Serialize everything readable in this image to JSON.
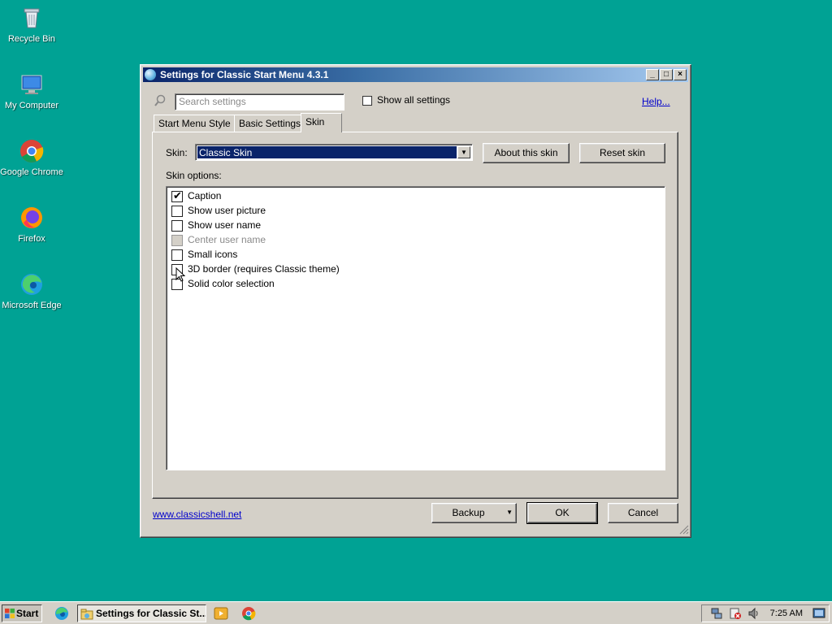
{
  "desktop": {
    "icons": [
      {
        "label": "Recycle Bin",
        "icon": "recycle-bin-icon"
      },
      {
        "label": "My Computer",
        "icon": "computer-icon"
      },
      {
        "label": "Google Chrome",
        "icon": "chrome-icon"
      },
      {
        "label": "Firefox",
        "icon": "firefox-icon"
      },
      {
        "label": "Microsoft Edge",
        "icon": "edge-icon"
      }
    ]
  },
  "window": {
    "title": "Settings for Classic Start Menu 4.3.1",
    "search_placeholder": "Search settings",
    "show_all_label": "Show all settings",
    "show_all_checked": false,
    "help_label": "Help...",
    "tabs": [
      {
        "label": "Start Menu Style",
        "active": false
      },
      {
        "label": "Basic Settings",
        "active": false
      },
      {
        "label": "Skin",
        "active": true
      }
    ],
    "skin_label": "Skin:",
    "skin_value": "Classic Skin",
    "about_skin_label": "About this skin",
    "reset_skin_label": "Reset skin",
    "skin_options_label": "Skin options:",
    "options": [
      {
        "label": "Caption",
        "checked": true,
        "enabled": true
      },
      {
        "label": "Show user picture",
        "checked": false,
        "enabled": true
      },
      {
        "label": "Show user name",
        "checked": false,
        "enabled": true
      },
      {
        "label": "Center user name",
        "checked": false,
        "enabled": false
      },
      {
        "label": "Small icons",
        "checked": false,
        "enabled": true
      },
      {
        "label": "3D border (requires Classic theme)",
        "checked": false,
        "enabled": true
      },
      {
        "label": "Solid color selection",
        "checked": false,
        "enabled": true
      }
    ],
    "website_link": "www.classicshell.net",
    "backup_label": "Backup",
    "ok_label": "OK",
    "cancel_label": "Cancel",
    "title_buttons": {
      "minimize": "_",
      "maximize": "□",
      "close": "×"
    }
  },
  "taskbar": {
    "start_label": "Start",
    "task_label": "Settings for Classic St...",
    "clock": "7:25 AM"
  },
  "colors": {
    "desktop": "#00a294",
    "title_start": "#0a246a",
    "title_end": "#a6caf0",
    "selection": "#0a246a"
  }
}
